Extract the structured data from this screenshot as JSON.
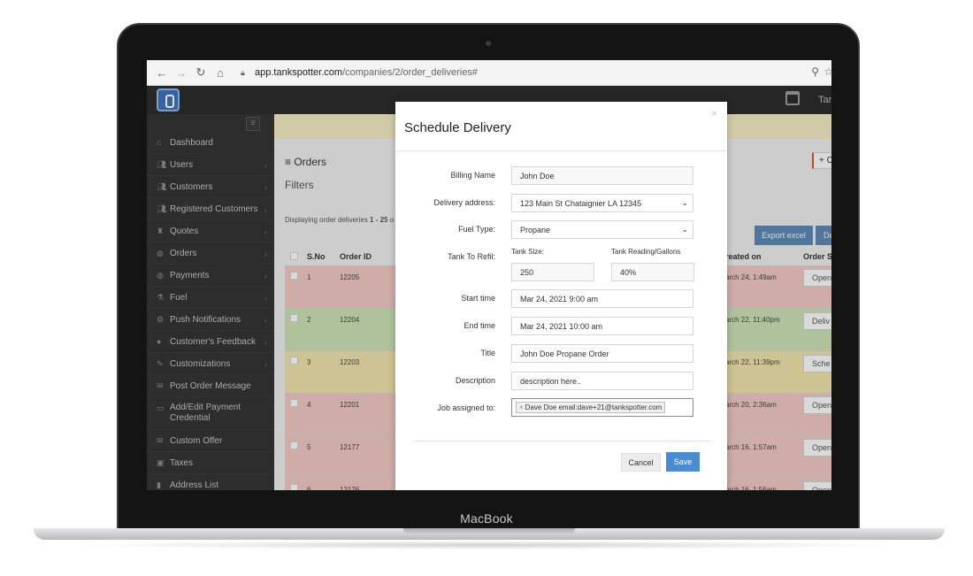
{
  "device": {
    "brand_label": "MacBook"
  },
  "browser": {
    "url_host": "app.tankspotter.com",
    "url_path": "/companies/2/order_deliveries#"
  },
  "topbar": {
    "user_partial": "Tar"
  },
  "sidebar": {
    "items": [
      {
        "label": "Dashboard",
        "icon": "dashboard-icon",
        "chevron": false
      },
      {
        "label": "Users",
        "icon": "users-icon",
        "chevron": true
      },
      {
        "label": "Customers",
        "icon": "users-icon",
        "chevron": true
      },
      {
        "label": "Registered Customers",
        "icon": "users-icon",
        "chevron": true
      },
      {
        "label": "Quotes",
        "icon": "binoculars-icon",
        "chevron": true
      },
      {
        "label": "Orders",
        "icon": "globe-icon",
        "chevron": true
      },
      {
        "label": "Payments",
        "icon": "globe-icon",
        "chevron": true
      },
      {
        "label": "Fuel",
        "icon": "flask-icon",
        "chevron": true
      },
      {
        "label": "Push Notifications",
        "icon": "cogs-icon",
        "chevron": true
      },
      {
        "label": "Customer's Feedback",
        "icon": "comment-icon",
        "chevron": true
      },
      {
        "label": "Customizations",
        "icon": "wrench-icon",
        "chevron": true
      },
      {
        "label": "Post Order Message",
        "icon": "envelope-icon",
        "chevron": false
      },
      {
        "label": "Add/Edit Payment Credential",
        "icon": "card-icon",
        "chevron": false
      },
      {
        "label": "Custom Offer",
        "icon": "envelope-icon",
        "chevron": false
      },
      {
        "label": "Taxes",
        "icon": "money-icon",
        "chevron": false
      },
      {
        "label": "Address List",
        "icon": "book-icon",
        "chevron": false
      }
    ]
  },
  "main": {
    "heading": "Orders",
    "filters": "Filters",
    "create_partial": "+ C",
    "displaying_prefix": "Displaying order deliveries ",
    "displaying_range": "1 - 25",
    "displaying_suffix": " o",
    "export_button": "Export excel",
    "second_button_partial": "De",
    "table": {
      "headers": {
        "sno": "S.No",
        "order_id": "Order ID",
        "created_on": "reated on",
        "status": "Order S"
      },
      "rows": [
        {
          "sno": "1",
          "order_id": "12205",
          "created": "arch 24, 1:49am",
          "status": "Open",
          "color": "#ecc4c0"
        },
        {
          "sno": "2",
          "order_id": "12204",
          "created": "arch 22, 11:40pm",
          "status": "Deliv",
          "color": "#c8ddb2"
        },
        {
          "sno": "3",
          "order_id": "12203",
          "created": "arch 22, 11:39pm",
          "status": "Sche",
          "color": "#eadfa8"
        },
        {
          "sno": "4",
          "order_id": "12201",
          "created": "arch 20, 2:36am",
          "status": "Open",
          "color": "#ecc4c0"
        },
        {
          "sno": "5",
          "order_id": "12177",
          "created": "arch 16, 1:57am",
          "status": "Open",
          "color": "#ecc4c0"
        },
        {
          "sno": "6",
          "order_id": "12176",
          "created": "arch 16, 1:56am",
          "status": "Open",
          "color": "#ecc4c0"
        }
      ]
    }
  },
  "modal": {
    "title": "Schedule Delivery",
    "close": "×",
    "billing_name": {
      "label": "Billing Name",
      "value": "John Doe"
    },
    "delivery_address": {
      "label": "Delivery address:",
      "value": "123 Main St Chataignier LA 12345"
    },
    "fuel_type": {
      "label": "Fuel Type:",
      "value": "Propane"
    },
    "tank_to_refill": {
      "label": "Tank To Refil:"
    },
    "tank_size": {
      "label": "Tank Size:",
      "value": "250"
    },
    "tank_reading": {
      "label": "Tank Reading/Gallons",
      "value": "40%"
    },
    "start_time": {
      "label": "Start time",
      "value": "Mar 24, 2021 9:00 am"
    },
    "end_time": {
      "label": "End time",
      "value": "Mar 24, 2021 10:00 am"
    },
    "title_field": {
      "label": "Title",
      "value": "John Doe Propane Order"
    },
    "description": {
      "label": "Description",
      "value": "description here.."
    },
    "job_assigned": {
      "label": "Job assigned to:",
      "chip": "Dave Doe email:dave+21@tankspotter.com",
      "chip_remove": "×"
    },
    "cancel_button": "Cancel",
    "save_button": "Save"
  }
}
